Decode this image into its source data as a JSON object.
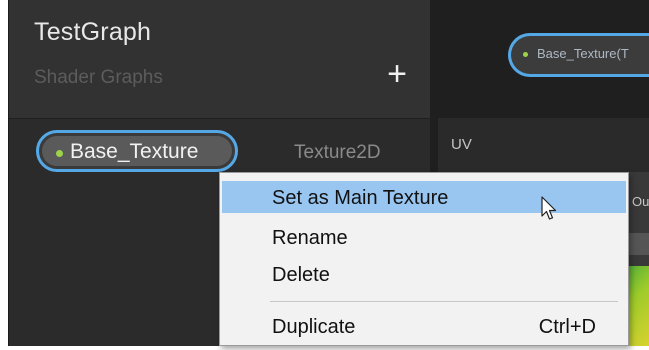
{
  "blackboard": {
    "title": "TestGraph",
    "subtitle": "Shader Graphs",
    "add_label": "+",
    "property": {
      "name": "Base_Texture",
      "type": "Texture2D"
    }
  },
  "graph": {
    "node_label": "Base_Texture(T",
    "uv_label": "UV",
    "out_label": "Ou"
  },
  "context_menu": {
    "items": [
      {
        "label": "Set as Main Texture",
        "shortcut": "",
        "highlighted": true
      },
      {
        "label": "Rename",
        "shortcut": ""
      },
      {
        "label": "Delete",
        "shortcut": ""
      },
      {
        "label": "Duplicate",
        "shortcut": "Ctrl+D"
      }
    ]
  },
  "colors": {
    "accent_blue": "#55a8e6",
    "property_dot": "#9dd34a",
    "menu_highlight": "#99c6f0"
  }
}
